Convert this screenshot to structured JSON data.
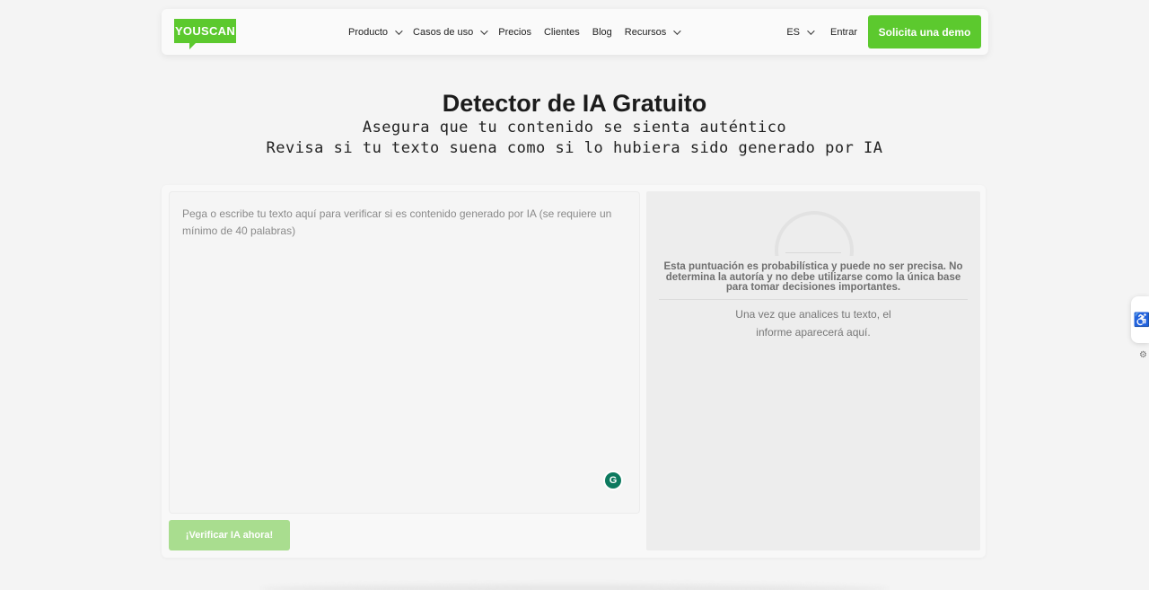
{
  "header": {
    "logo_text": "YOUSCAN",
    "nav": [
      {
        "label": "Producto",
        "dropdown": true
      },
      {
        "label": "Casos de uso",
        "dropdown": true
      },
      {
        "label": "Precios",
        "dropdown": false
      },
      {
        "label": "Clientes",
        "dropdown": false
      },
      {
        "label": "Blog",
        "dropdown": false
      },
      {
        "label": "Recursos",
        "dropdown": true
      }
    ],
    "lang": "ES",
    "login": "Entrar",
    "demo_button": "Solicita una demo"
  },
  "hero": {
    "title": "Detector de IA Gratuito",
    "subtitle_1": "Asegura que tu contenido se sienta auténtico",
    "subtitle_2": "Revisa si tu texto suena como si lo hubiera sido generado por IA"
  },
  "editor": {
    "placeholder": "Pega o escribe tu texto aquí para verificar si es contenido generado por IA (se requiere un mínimo de 40 palabras)",
    "value": "",
    "grammarly_glyph": "G",
    "verify_button": "¡Verificar IA ahora!"
  },
  "result": {
    "disclaimer": "Esta puntuación es probabilística y puede no ser precisa. No determina la autoría y no debe utilizarse como la única base para tomar decisiones importantes.",
    "empty_note": "Una vez que analices tu texto, el informe aparecerá aquí."
  },
  "side": {
    "accessibility_glyph": "♿",
    "gear_glyph": "⚙"
  },
  "colors": {
    "brand_green": "#5cc92e",
    "disabled_green": "#a9dd8f",
    "background": "#f4f4f4"
  }
}
